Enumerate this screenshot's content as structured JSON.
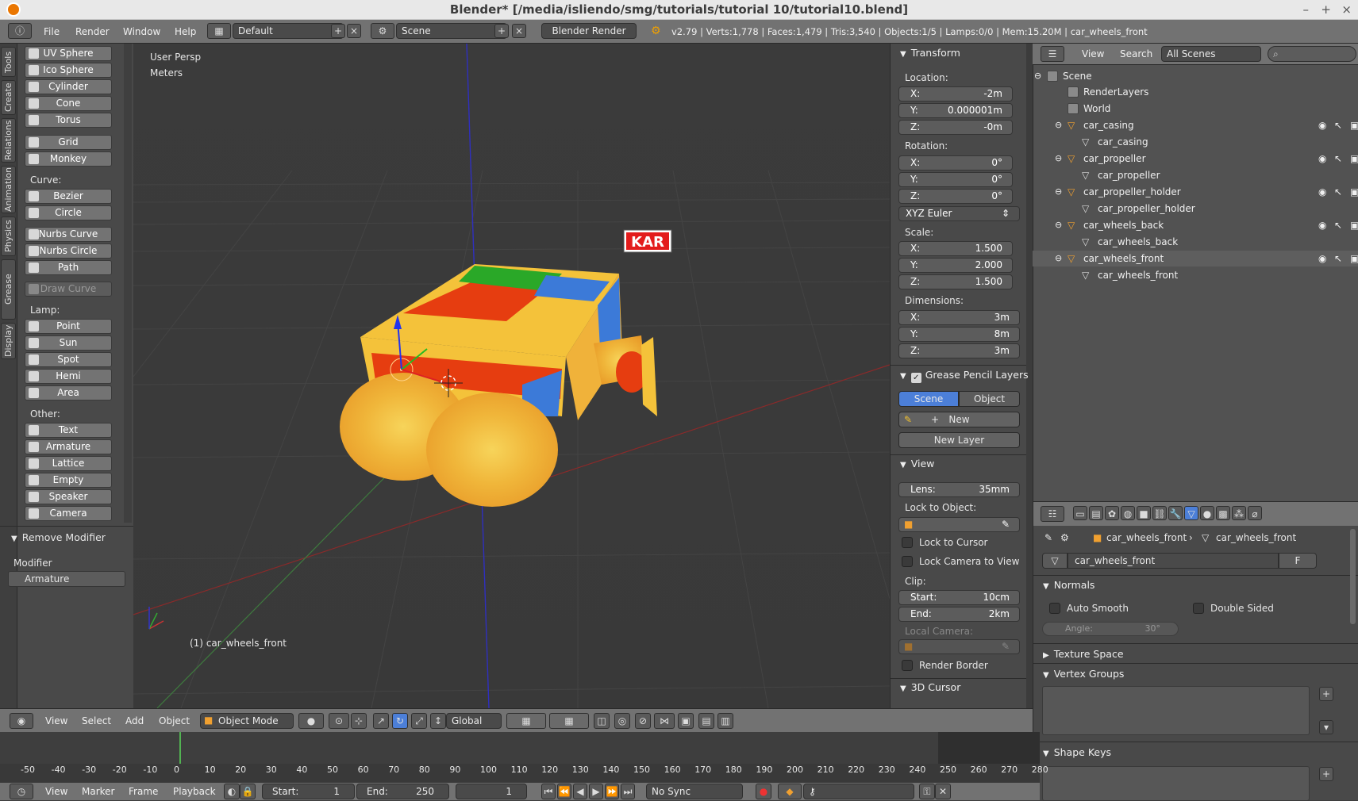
{
  "window": {
    "title": "Blender* [/media/isliendo/smg/tutorials/tutorial 10/tutorial10.blend]",
    "min": "–",
    "max": "+",
    "close": "×"
  },
  "menubar": {
    "items": [
      "File",
      "Render",
      "Window",
      "Help"
    ],
    "layout": "Default",
    "scene": "Scene",
    "engine": "Blender Render",
    "stats": "v2.79 | Verts:1,778 | Faces:1,479 | Tris:3,540 | Objects:1/5 | Lamps:0/0 | Mem:15.20M | car_wheels_front"
  },
  "tabs": [
    "Tools",
    "Create",
    "Relations",
    "Animation",
    "Physics",
    "Grease Pencil",
    "Display"
  ],
  "tools": {
    "mesh": [
      "UV Sphere",
      "Ico Sphere",
      "Cylinder",
      "Cone",
      "Torus",
      "Grid",
      "Monkey"
    ],
    "curve_label": "Curve:",
    "curve": [
      "Bezier",
      "Circle",
      "Nurbs Curve",
      "Nurbs Circle",
      "Path",
      "Draw Curve"
    ],
    "lamp_label": "Lamp:",
    "lamp": [
      "Point",
      "Sun",
      "Spot",
      "Hemi",
      "Area"
    ],
    "other_label": "Other:",
    "other": [
      "Text",
      "Armature",
      "Lattice",
      "Empty",
      "Speaker",
      "Camera"
    ],
    "remove_modifier": "Remove Modifier",
    "modifier_label": "Modifier",
    "modifier_value": "Armature"
  },
  "viewport": {
    "persp": "User Persp",
    "units": "Meters",
    "object_label": "(1) car_wheels_front",
    "sign": "KAR"
  },
  "viewheader": {
    "view": "View",
    "select": "Select",
    "add": "Add",
    "object": "Object",
    "mode": "Object Mode",
    "orientation": "Global"
  },
  "npanel": {
    "transform": "Transform",
    "location": "Location:",
    "rotation": "Rotation:",
    "scale": "Scale:",
    "dimensions": "Dimensions:",
    "loc": [
      {
        "a": "X:",
        "v": "-2m"
      },
      {
        "a": "Y:",
        "v": "0.000001m"
      },
      {
        "a": "Z:",
        "v": "-0m"
      }
    ],
    "rot": [
      {
        "a": "X:",
        "v": "0°"
      },
      {
        "a": "Y:",
        "v": "0°"
      },
      {
        "a": "Z:",
        "v": "0°"
      }
    ],
    "rotmode": "XYZ Euler",
    "scl": [
      {
        "a": "X:",
        "v": "1.500"
      },
      {
        "a": "Y:",
        "v": "2.000"
      },
      {
        "a": "Z:",
        "v": "1.500"
      }
    ],
    "dim": [
      {
        "a": "X:",
        "v": "3m"
      },
      {
        "a": "Y:",
        "v": "8m"
      },
      {
        "a": "Z:",
        "v": "3m"
      }
    ],
    "gp_layers": "Grease Pencil Layers",
    "gp_scene": "Scene",
    "gp_object": "Object",
    "gp_new": "New",
    "gp_new_layer": "New Layer",
    "view": "View",
    "lens_label": "Lens:",
    "lens": "35mm",
    "lock_to_object": "Lock to Object:",
    "lock_cursor": "Lock to Cursor",
    "lock_camera": "Lock Camera to View",
    "clip": "Clip:",
    "clip_start_label": "Start:",
    "clip_start": "10cm",
    "clip_end_label": "End:",
    "clip_end": "2km",
    "local_camera": "Local Camera:",
    "render_border": "Render Border",
    "cursor3d": "3D Cursor"
  },
  "outliner": {
    "view": "View",
    "search": "Search",
    "filter": "All Scenes",
    "rows": [
      {
        "label": "Scene",
        "indent": 0
      },
      {
        "label": "RenderLayers",
        "indent": 1
      },
      {
        "label": "World",
        "indent": 1
      },
      {
        "label": "car_casing",
        "indent": 1
      },
      {
        "label": "car_casing",
        "indent": 2
      },
      {
        "label": "car_propeller",
        "indent": 1
      },
      {
        "label": "car_propeller",
        "indent": 2
      },
      {
        "label": "car_propeller_holder",
        "indent": 1
      },
      {
        "label": "car_propeller_holder",
        "indent": 2
      },
      {
        "label": "car_wheels_back",
        "indent": 1
      },
      {
        "label": "car_wheels_back",
        "indent": 2
      },
      {
        "label": "car_wheels_front",
        "indent": 1
      },
      {
        "label": "car_wheels_front",
        "indent": 2
      }
    ]
  },
  "props": {
    "crumb_obj": "car_wheels_front",
    "crumb_mesh": "car_wheels_front",
    "mesh_name": "car_wheels_front",
    "fake": "F",
    "normals": "Normals",
    "auto_smooth": "Auto Smooth",
    "double_sided": "Double Sided",
    "angle_label": "Angle:",
    "angle": "30°",
    "texture_space": "Texture Space",
    "vertex_groups": "Vertex Groups",
    "shape_keys": "Shape Keys"
  },
  "timeline": {
    "ticks": [
      "-50",
      "-40",
      "-30",
      "-20",
      "-10",
      "0",
      "10",
      "20",
      "30",
      "40",
      "50",
      "60",
      "70",
      "80",
      "90",
      "100",
      "110",
      "120",
      "130",
      "140",
      "150",
      "160",
      "170",
      "180",
      "190",
      "200",
      "210",
      "220",
      "230",
      "240",
      "250",
      "260",
      "270",
      "280"
    ],
    "view": "View",
    "marker": "Marker",
    "frame": "Frame",
    "playback": "Playback",
    "start_label": "Start:",
    "start": "1",
    "end_label": "End:",
    "end": "250",
    "current": "1",
    "sync": "No Sync"
  }
}
